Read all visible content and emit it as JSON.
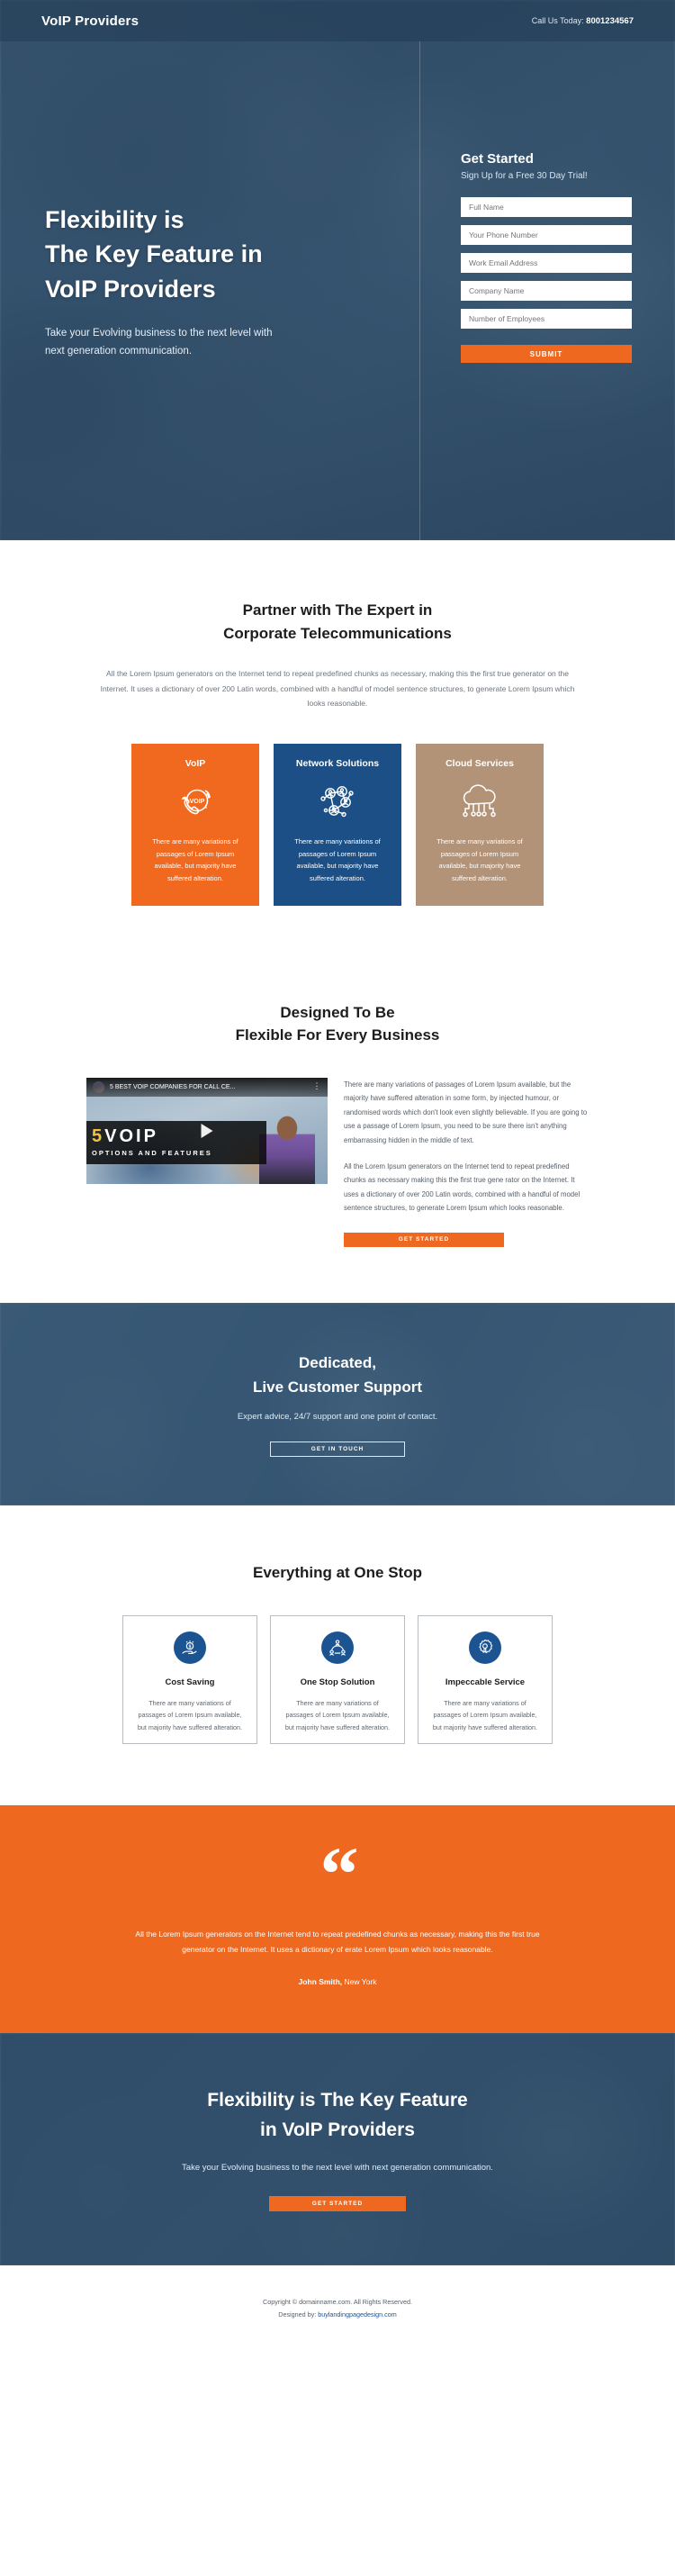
{
  "header": {
    "brand": "VoIP Providers",
    "call_label": "Call Us Today:",
    "phone": "8001234567"
  },
  "hero": {
    "title_line1": "Flexibility is",
    "title_line2": "The Key Feature in",
    "title_line3": "VoIP Providers",
    "subtitle": "Take your Evolving business to the next level with next generation communication.",
    "form": {
      "title": "Get Started",
      "subtitle": "Sign Up for a Free 30 Day Trial!",
      "fields": [
        {
          "name": "full-name",
          "placeholder": "Full Name",
          "value": ""
        },
        {
          "name": "phone",
          "placeholder": "Your Phone Number",
          "value": ""
        },
        {
          "name": "email",
          "placeholder": "Work Email Address",
          "value": ""
        },
        {
          "name": "company",
          "placeholder": "Company Name",
          "value": ""
        },
        {
          "name": "employees",
          "placeholder": "Number of Employees",
          "value": ""
        }
      ],
      "submit_label": "SUBMIT"
    }
  },
  "partner": {
    "title_line1": "Partner with The Expert in",
    "title_line2": "Corporate Telecommunications",
    "lead": "All the Lorem Ipsum generators on the Internet tend to repeat predefined chunks as necessary, making this the first true generator on the Internet. It uses a dictionary of over 200 Latin words, combined with a handful of model sentence structures, to generate Lorem Ipsum which looks reasonable.",
    "cards": [
      {
        "title": "VoIP",
        "icon": "voip-phone-icon",
        "text": "There are many variations of passages of Lorem Ipsum available, but majority have suffered alteration.",
        "color": "#f0691f"
      },
      {
        "title": "Network Solutions",
        "icon": "network-nodes-icon",
        "text": "There are many variations of passages of Lorem Ipsum available, but majority have suffered alteration.",
        "color": "#1c4f86"
      },
      {
        "title": "Cloud Services",
        "icon": "cloud-circuit-icon",
        "text": "There are many variations of passages of Lorem Ipsum available, but majority have suffered alteration.",
        "color": "#b39377"
      }
    ]
  },
  "flexible": {
    "title_line1": "Designed To Be",
    "title_line2": "Flexible For Every Business",
    "video": {
      "title": "5 BEST VOIP COMPANIES FOR CALL CE...",
      "caption_number": "5",
      "caption_main": "VOIP",
      "caption_sub": "OPTIONS AND FEATURES"
    },
    "paragraph1": "There are many variations of passages of Lorem Ipsum available, but the majority have suffered alteration in some form, by injected humour, or randomised words which don't look even slightly believable. If you are going to use a passage of Lorem Ipsum, you need to be sure there isn't anything embarrassing hidden in the middle of text.",
    "paragraph2": "All the Lorem Ipsum generators on the Internet tend to repeat predefined chunks as necessary making this the first true gene rator on the Internet. It uses a dictionary of over 200 Latin words, combined with a handful of model sentence structures, to generate Lorem Ipsum which looks reasonable.",
    "cta_label": "GET STARTED"
  },
  "support": {
    "title_line1": "Dedicated,",
    "title_line2": "Live Customer Support",
    "subtitle": "Expert advice, 24/7 support and one point of contact.",
    "cta_label": "GET IN TOUCH"
  },
  "onestop": {
    "title": "Everything at One Stop",
    "cards": [
      {
        "title": "Cost Saving",
        "icon": "money-hand-icon",
        "text": "There are many variations of passages of Lorem Ipsum available, but majority have suffered alteration."
      },
      {
        "title": "One Stop Solution",
        "icon": "people-network-icon",
        "text": "There are many variations of passages of Lorem Ipsum available, but majority have suffered alteration."
      },
      {
        "title": "Impeccable Service",
        "icon": "gear-wrench-icon",
        "text": "There are many variations of passages of Lorem Ipsum available, but majority have suffered alteration."
      }
    ]
  },
  "testimonial": {
    "quote_icon": "quotation-mark-icon",
    "text": "All the Lorem Ipsum generators on the Internet tend to repeat predefined chunks as necessary, making this the first true generator on the Internet. It uses a dictionary of erate Lorem Ipsum which looks reasonable.",
    "author_name": "John Smith,",
    "author_location": "New York"
  },
  "cta": {
    "title_line1": "Flexibility is The Key Feature",
    "title_line2": "in VoIP Providers",
    "subtitle": "Take your Evolving business to the next level with next generation communication.",
    "button_label": "GET STARTED"
  },
  "footer": {
    "copyright": "Copyright © domainname.com. All Rights Reserved.",
    "designed_prefix": "Designed by:",
    "designed_link": "buylandingpagedesign.com"
  },
  "colors": {
    "orange": "#ef6820",
    "blue": "#1c5492",
    "dark_blue": "#1c4f86",
    "tan": "#b39377",
    "hero_overlay": "#2a4865"
  }
}
